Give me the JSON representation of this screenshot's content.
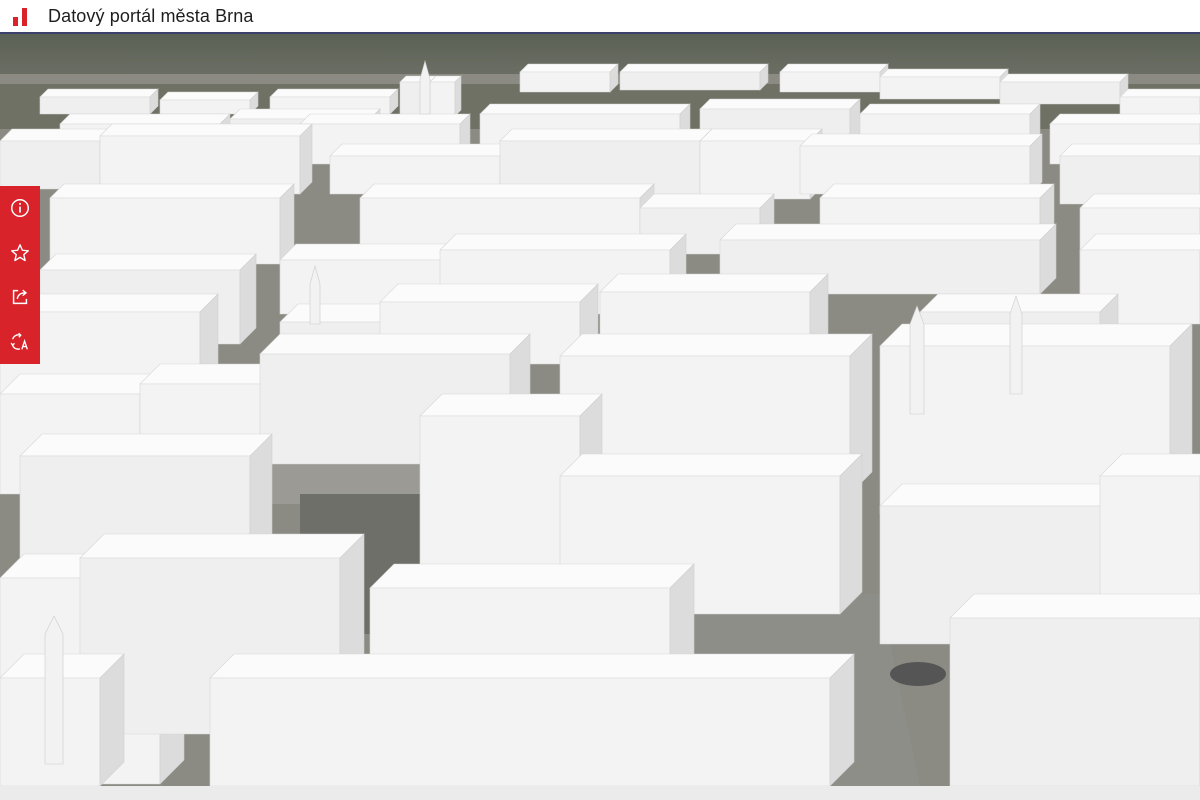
{
  "header": {
    "title": "Datový portál města Brna",
    "logo_icon": "bar-chart-logo-icon"
  },
  "theme": {
    "brand": "#d8232a",
    "building": "#f1f1f1",
    "ground": "#85857d"
  },
  "toolbar": {
    "items": [
      {
        "icon": "info-icon"
      },
      {
        "icon": "star-icon"
      },
      {
        "icon": "share-icon"
      },
      {
        "icon": "translate-icon"
      }
    ]
  }
}
